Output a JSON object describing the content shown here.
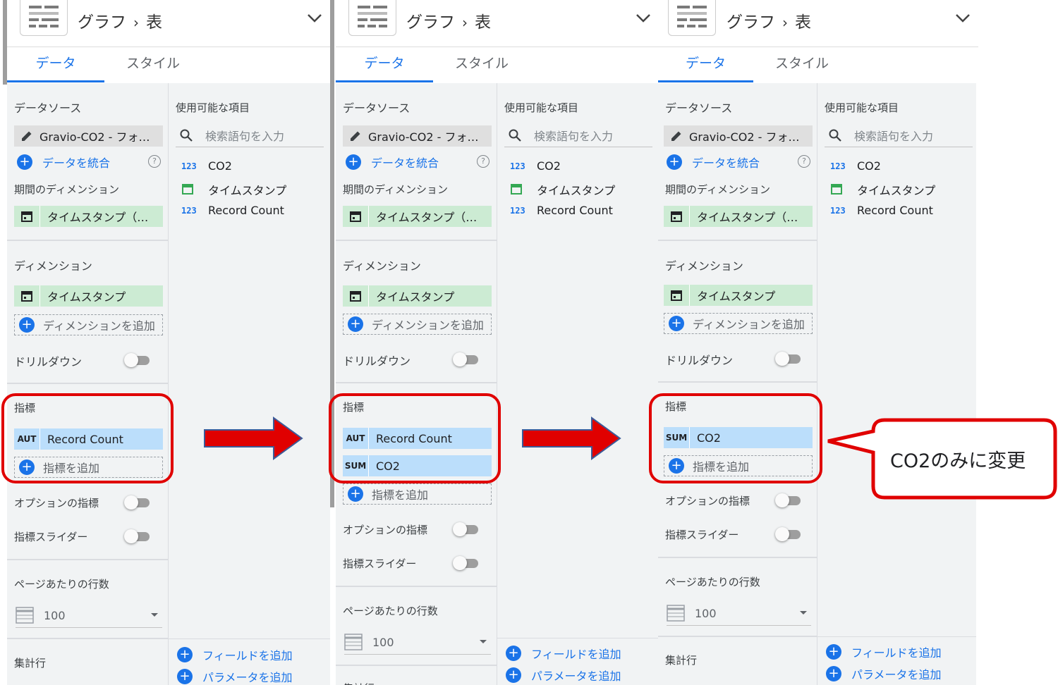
{
  "header": {
    "breadcrumb_parent": "グラフ",
    "breadcrumb_sep": "›",
    "breadcrumb_current": "表"
  },
  "tabs": {
    "data": "データ",
    "style": "スタイル"
  },
  "left": {
    "datasource_title": "データソース",
    "datasource_name": "Gravio-CO2 - フォ…",
    "blend_data": "データを統合",
    "date_range_title": "期間のディメンション",
    "date_range_value": "タイムスタンプ（…",
    "dimension_title": "ディメンション",
    "dimension_value": "タイムスタンプ",
    "add_dimension": "ディメンションを追加",
    "drilldown": "ドリルダウン",
    "metric_title": "指標",
    "add_metric": "指標を追加",
    "optional_metrics": "オプションの指標",
    "metric_slider": "指標スライダー",
    "rows_per_page_title": "ページあたりの行数",
    "rows_per_page_value": "100",
    "summary_row": "集計行"
  },
  "right": {
    "available_title": "使用可能な項目",
    "search_placeholder": "検索語句を入力",
    "fields": [
      {
        "type": "123",
        "name": "CO2"
      },
      {
        "type": "calendar",
        "name": "タイムスタンプ"
      },
      {
        "type": "123",
        "name": "Record Count"
      }
    ],
    "add_field": "フィールドを追加",
    "add_parameter": "パラメータを追加"
  },
  "metrics": {
    "panel1": [
      {
        "agg": "AUT",
        "name": "Record Count"
      }
    ],
    "panel2": [
      {
        "agg": "AUT",
        "name": "Record Count"
      },
      {
        "agg": "SUM",
        "name": "CO2"
      }
    ],
    "panel3": [
      {
        "agg": "SUM",
        "name": "CO2"
      }
    ]
  },
  "callout_text": "CO2のみに変更",
  "colors": {
    "accent": "#1a73e8",
    "highlight": "#e00000",
    "green_chip": "#ccebd3",
    "blue_chip": "#bbdefb",
    "panel_bg": "#f1f3f4"
  }
}
